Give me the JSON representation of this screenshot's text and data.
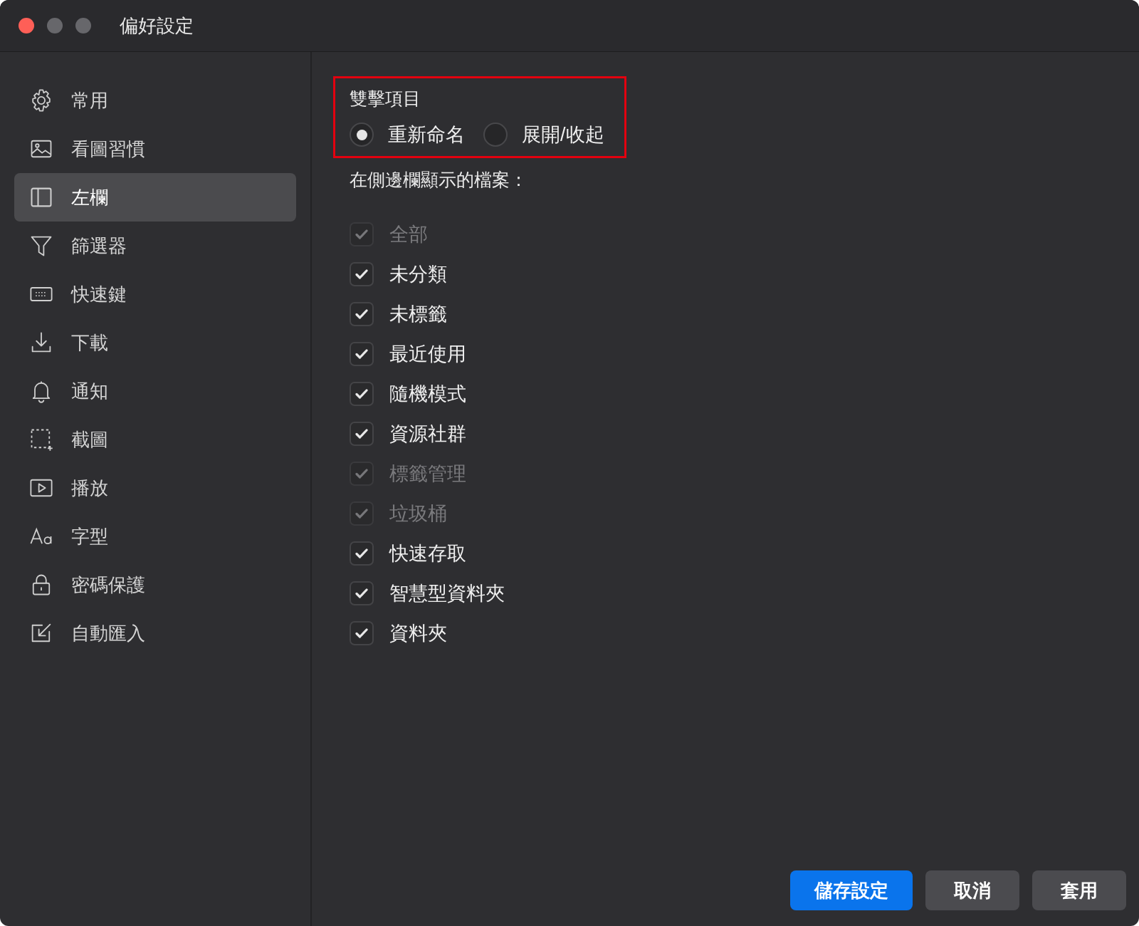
{
  "window": {
    "title": "偏好設定"
  },
  "sidebar": {
    "items": [
      {
        "label": "常用",
        "selected": false
      },
      {
        "label": "看圖習慣",
        "selected": false
      },
      {
        "label": "左欄",
        "selected": true
      },
      {
        "label": "篩選器",
        "selected": false
      },
      {
        "label": "快速鍵",
        "selected": false
      },
      {
        "label": "下載",
        "selected": false
      },
      {
        "label": "通知",
        "selected": false
      },
      {
        "label": "截圖",
        "selected": false
      },
      {
        "label": "播放",
        "selected": false
      },
      {
        "label": "字型",
        "selected": false
      },
      {
        "label": "密碼保護",
        "selected": false
      },
      {
        "label": "自動匯入",
        "selected": false
      }
    ]
  },
  "double_click": {
    "title": "雙擊項目",
    "highlighted": true,
    "options": [
      {
        "label": "重新命名",
        "selected": true
      },
      {
        "label": "展開/收起",
        "selected": false
      }
    ]
  },
  "sidebar_files": {
    "title": "在側邊欄顯示的檔案：",
    "items": [
      {
        "label": "全部",
        "checked": true,
        "disabled": true
      },
      {
        "label": "未分類",
        "checked": true,
        "disabled": false
      },
      {
        "label": "未標籤",
        "checked": true,
        "disabled": false
      },
      {
        "label": "最近使用",
        "checked": true,
        "disabled": false
      },
      {
        "label": "隨機模式",
        "checked": true,
        "disabled": false
      },
      {
        "label": "資源社群",
        "checked": true,
        "disabled": false
      },
      {
        "label": "標籤管理",
        "checked": true,
        "disabled": true
      },
      {
        "label": "垃圾桶",
        "checked": true,
        "disabled": true
      },
      {
        "label": "快速存取",
        "checked": true,
        "disabled": false
      },
      {
        "label": "智慧型資料夾",
        "checked": true,
        "disabled": false
      },
      {
        "label": "資料夾",
        "checked": true,
        "disabled": false
      }
    ]
  },
  "buttons": [
    {
      "label": "儲存設定",
      "kind": "primary"
    },
    {
      "label": "取消",
      "kind": "secondary"
    },
    {
      "label": "套用",
      "kind": "secondary"
    }
  ]
}
